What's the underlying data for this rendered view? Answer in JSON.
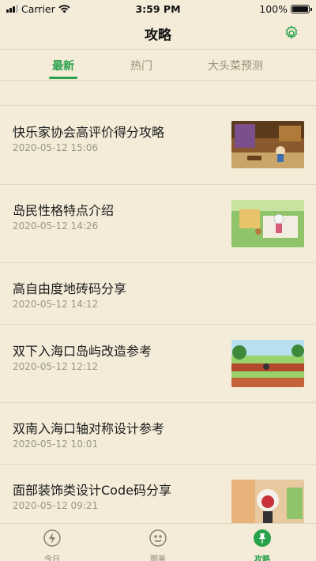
{
  "status_bar": {
    "carrier": "Carrier",
    "time": "3:59 PM",
    "battery": "100%",
    "icons": [
      "signal-icon",
      "wifi-icon",
      "battery-icon"
    ]
  },
  "nav": {
    "title": "攻略",
    "settings_icon": "gear-icon"
  },
  "tabs": [
    {
      "label": "最新",
      "active": true
    },
    {
      "label": "热门",
      "active": false
    },
    {
      "label": "大头菜预测",
      "active": false
    }
  ],
  "articles": [
    {
      "title": "快乐家协会高评价得分攻略",
      "date": "2020-05-12 15:06",
      "has_thumb": true
    },
    {
      "title": "岛民性格特点介绍",
      "date": "2020-05-12 14:26",
      "has_thumb": true
    },
    {
      "title": "高自由度地砖码分享",
      "date": "2020-05-12 14:12",
      "has_thumb": false
    },
    {
      "title": "双下入海口岛屿改造参考",
      "date": "2020-05-12 12:12",
      "has_thumb": true
    },
    {
      "title": "双南入海口轴对称设计参考",
      "date": "2020-05-12 10:01",
      "has_thumb": false
    },
    {
      "title": "面部装饰类设计Code码分享",
      "date": "2020-05-12 09:21",
      "has_thumb": true
    }
  ],
  "tab_bar": [
    {
      "label": "今日",
      "icon": "lightning-icon",
      "active": false
    },
    {
      "label": "图鉴",
      "icon": "smiley-icon",
      "active": false
    },
    {
      "label": "攻略",
      "icon": "pin-icon",
      "active": true
    }
  ],
  "colors": {
    "background": "#f4ecd9",
    "accent": "#2aa14b",
    "muted": "#9a8f77"
  }
}
